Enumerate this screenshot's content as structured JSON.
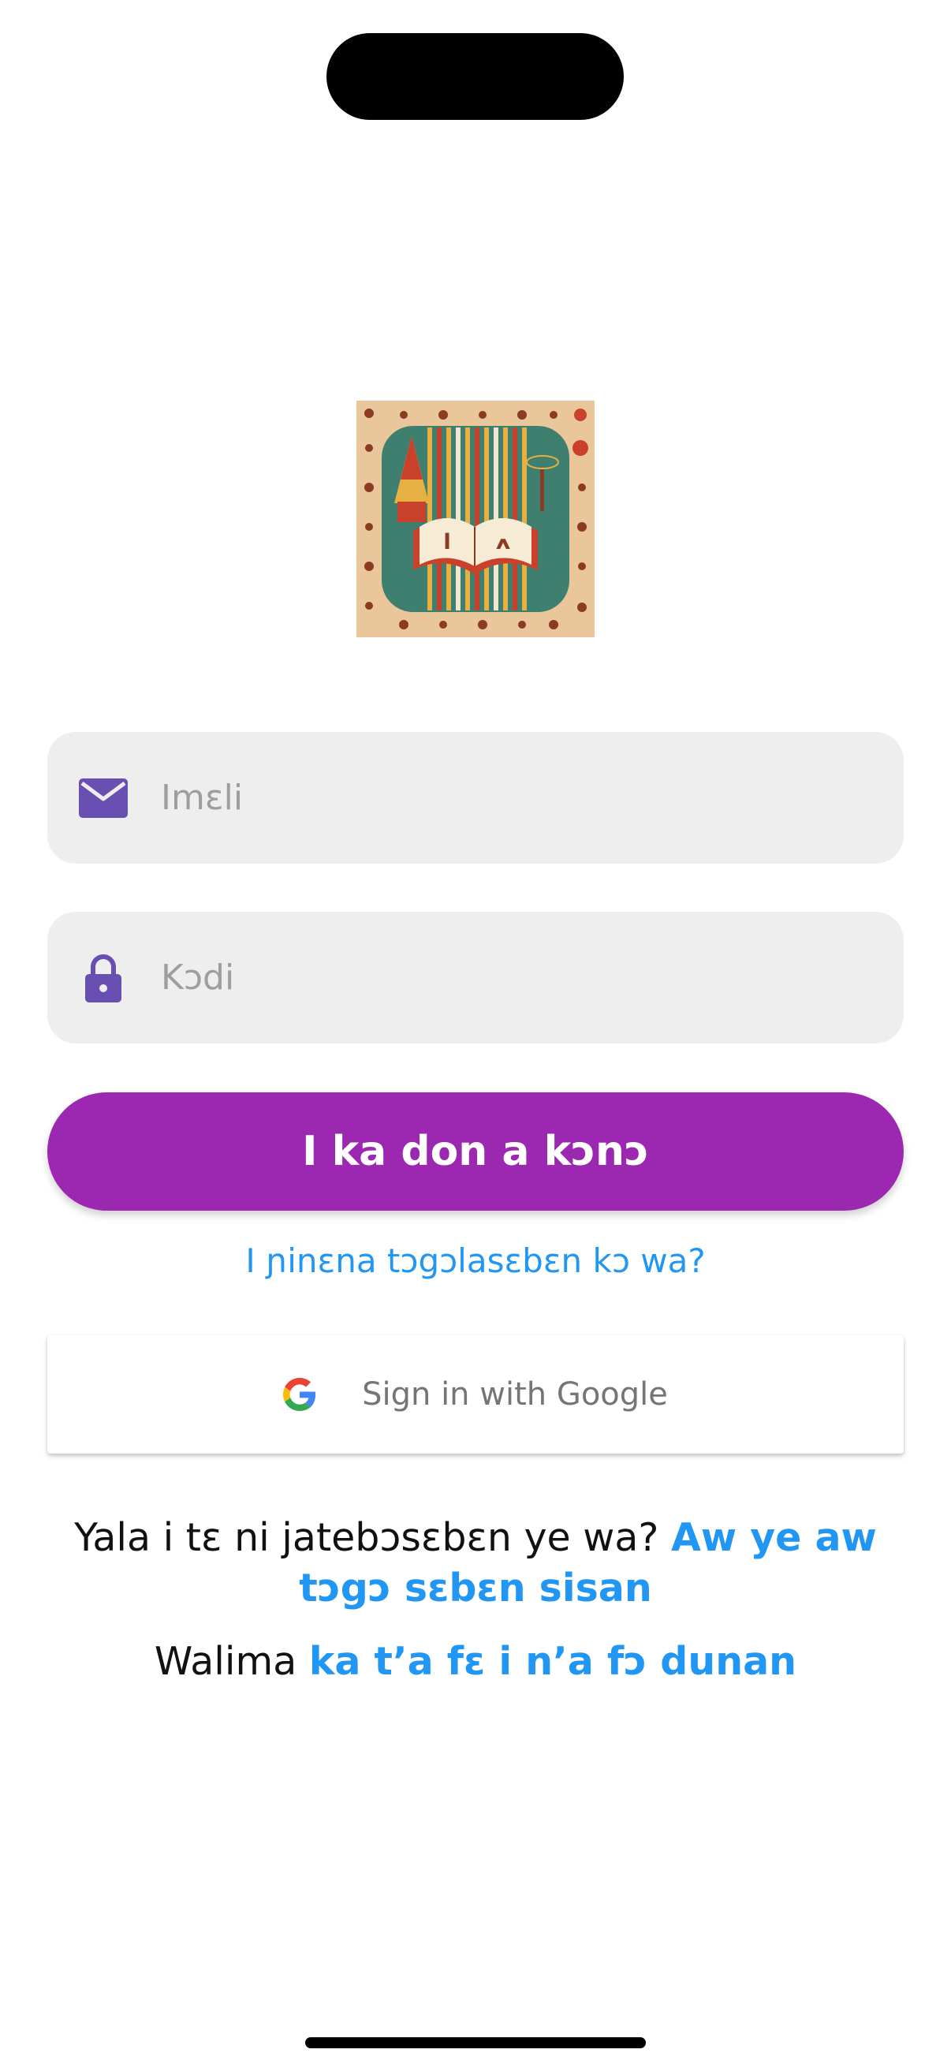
{
  "logo": {
    "icon": "book-logo-icon",
    "glyphs": [
      "ߊ",
      "ߍ"
    ]
  },
  "email_field": {
    "icon": "envelope-icon",
    "placeholder": "Imɛli",
    "value": ""
  },
  "password_field": {
    "icon": "lock-icon",
    "placeholder": "Kɔdi",
    "value": ""
  },
  "login_button": {
    "label": "I ka don a kɔnɔ"
  },
  "forgot_password": {
    "label": "I ɲinɛna tɔgɔlasɛbɛn kɔ wa?"
  },
  "google_button": {
    "icon": "google-icon",
    "label": "Sign in with Google"
  },
  "signup": {
    "prompt": "Yala i tɛ ni jatebɔsɛbɛn ye wa?",
    "link": "Aw ye aw tɔgɔ sɛbɛn sisan"
  },
  "guest": {
    "prompt": "Walima",
    "link": "ka tʼa fɛ i nʼa fɔ dunan"
  },
  "colors": {
    "accent": "#9c27b0",
    "link": "#2196f3",
    "icon": "#6a4fb3",
    "field_bg": "#eeeeee"
  }
}
